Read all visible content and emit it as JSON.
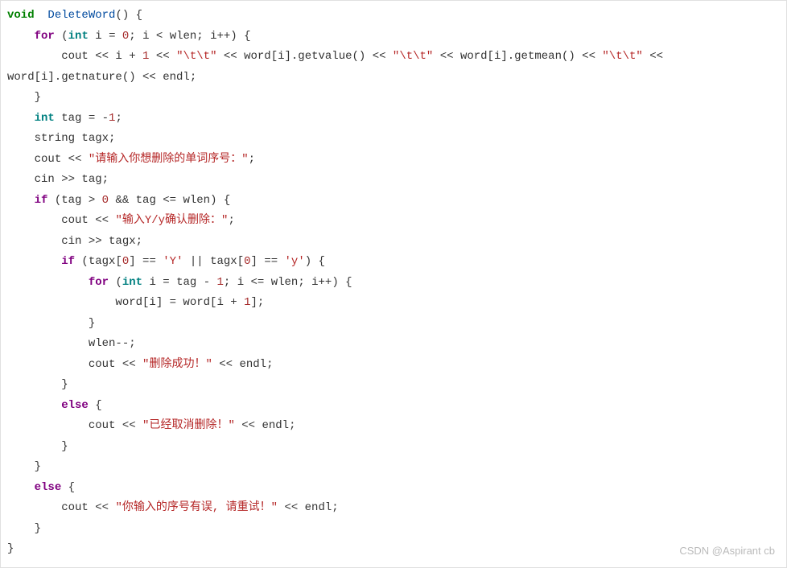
{
  "code": {
    "lines": [
      {
        "indent": 0,
        "tokens": [
          [
            "kw-void",
            "void"
          ],
          [
            "op",
            "  "
          ],
          [
            "fn",
            "DeleteWord"
          ],
          [
            "op",
            "() {"
          ]
        ]
      },
      {
        "indent": 1,
        "tokens": [
          [
            "kw-for",
            "for"
          ],
          [
            "op",
            " ("
          ],
          [
            "kw-int",
            "int"
          ],
          [
            "op",
            " i = "
          ],
          [
            "num",
            "0"
          ],
          [
            "op",
            "; i < wlen; i++) {"
          ]
        ]
      },
      {
        "indent": 2,
        "tokens": [
          [
            "op",
            "cout << i + "
          ],
          [
            "num",
            "1"
          ],
          [
            "op",
            " << "
          ],
          [
            "str",
            "\"\\t\\t\""
          ],
          [
            "op",
            " << word[i].getvalue() << "
          ],
          [
            "str",
            "\"\\t\\t\""
          ],
          [
            "op",
            " << word[i].getmean() << "
          ],
          [
            "str",
            "\"\\t\\t\""
          ],
          [
            "op",
            " <<"
          ]
        ]
      },
      {
        "indent": -1,
        "tokens": [
          [
            "op",
            "word[i].getnature() << endl;"
          ]
        ]
      },
      {
        "indent": 1,
        "tokens": [
          [
            "op",
            "}"
          ]
        ]
      },
      {
        "indent": 1,
        "tokens": [
          [
            "kw-int",
            "int"
          ],
          [
            "op",
            " tag = -"
          ],
          [
            "num",
            "1"
          ],
          [
            "op",
            ";"
          ]
        ]
      },
      {
        "indent": 1,
        "tokens": [
          [
            "op",
            "string tagx;"
          ]
        ]
      },
      {
        "indent": 1,
        "tokens": [
          [
            "op",
            "cout << "
          ],
          [
            "str",
            "\"请输入你想删除的单词序号：\""
          ],
          [
            "op",
            ";"
          ]
        ]
      },
      {
        "indent": 1,
        "tokens": [
          [
            "op",
            "cin >> tag;"
          ]
        ]
      },
      {
        "indent": 1,
        "tokens": [
          [
            "kw-if",
            "if"
          ],
          [
            "op",
            " (tag > "
          ],
          [
            "num",
            "0"
          ],
          [
            "op",
            " && tag <= wlen) {"
          ]
        ]
      },
      {
        "indent": 2,
        "tokens": [
          [
            "op",
            "cout << "
          ],
          [
            "str",
            "\"输入Y/y确认删除：\""
          ],
          [
            "op",
            ";"
          ]
        ]
      },
      {
        "indent": 2,
        "tokens": [
          [
            "op",
            "cin >> tagx;"
          ]
        ]
      },
      {
        "indent": 2,
        "tokens": [
          [
            "kw-if",
            "if"
          ],
          [
            "op",
            " (tagx["
          ],
          [
            "num",
            "0"
          ],
          [
            "op",
            "] == "
          ],
          [
            "str",
            "'Y'"
          ],
          [
            "op",
            " || tagx["
          ],
          [
            "num",
            "0"
          ],
          [
            "op",
            "] == "
          ],
          [
            "str",
            "'y'"
          ],
          [
            "op",
            ") {"
          ]
        ]
      },
      {
        "indent": 3,
        "tokens": [
          [
            "kw-for",
            "for"
          ],
          [
            "op",
            " ("
          ],
          [
            "kw-int",
            "int"
          ],
          [
            "op",
            " i = tag - "
          ],
          [
            "num",
            "1"
          ],
          [
            "op",
            "; i <= wlen; i++) {"
          ]
        ]
      },
      {
        "indent": 4,
        "tokens": [
          [
            "op",
            "word[i] = word[i + "
          ],
          [
            "num",
            "1"
          ],
          [
            "op",
            "];"
          ]
        ]
      },
      {
        "indent": 3,
        "tokens": [
          [
            "op",
            "}"
          ]
        ]
      },
      {
        "indent": 3,
        "tokens": [
          [
            "op",
            "wlen--;"
          ]
        ]
      },
      {
        "indent": 3,
        "tokens": [
          [
            "op",
            "cout << "
          ],
          [
            "str",
            "\"删除成功！\""
          ],
          [
            "op",
            " << endl;"
          ]
        ]
      },
      {
        "indent": 2,
        "tokens": [
          [
            "op",
            "}"
          ]
        ]
      },
      {
        "indent": 2,
        "tokens": [
          [
            "kw-else",
            "else"
          ],
          [
            "op",
            " {"
          ]
        ]
      },
      {
        "indent": 3,
        "tokens": [
          [
            "op",
            "cout << "
          ],
          [
            "str",
            "\"已经取消删除！\""
          ],
          [
            "op",
            " << endl;"
          ]
        ]
      },
      {
        "indent": 2,
        "tokens": [
          [
            "op",
            "}"
          ]
        ]
      },
      {
        "indent": 1,
        "tokens": [
          [
            "op",
            "}"
          ]
        ]
      },
      {
        "indent": 1,
        "tokens": [
          [
            "kw-else",
            "else"
          ],
          [
            "op",
            " {"
          ]
        ]
      },
      {
        "indent": 2,
        "tokens": [
          [
            "op",
            "cout << "
          ],
          [
            "str",
            "\"你输入的序号有误, 请重试！\""
          ],
          [
            "op",
            " << endl;"
          ]
        ]
      },
      {
        "indent": 1,
        "tokens": [
          [
            "op",
            "}"
          ]
        ]
      },
      {
        "indent": 0,
        "tokens": [
          [
            "op",
            "}"
          ]
        ]
      }
    ]
  },
  "watermark": "CSDN @Aspirant cb"
}
